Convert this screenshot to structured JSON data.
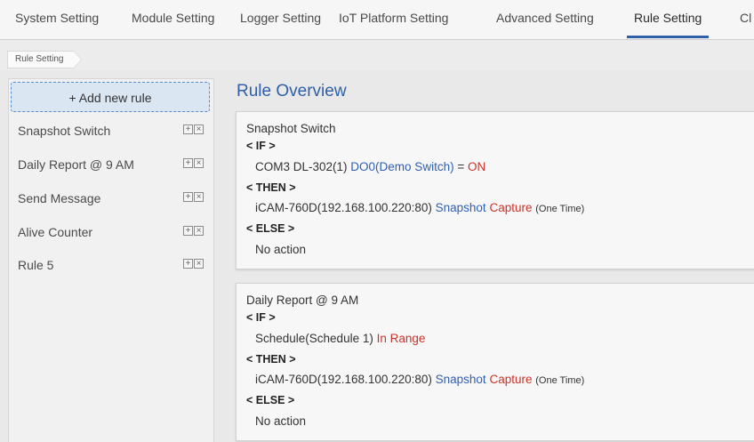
{
  "nav": {
    "tabs": [
      {
        "label": "System Setting"
      },
      {
        "label": "Module Setting"
      },
      {
        "label": "Logger Setting"
      },
      {
        "label": "IoT Platform Setting"
      },
      {
        "label": "Advanced Setting"
      },
      {
        "label": "Rule Setting",
        "active": true
      },
      {
        "label": "Cl"
      }
    ]
  },
  "breadcrumb": {
    "label": "Rule Setting"
  },
  "sidebar": {
    "add_label": "+ Add new rule",
    "rules": [
      {
        "label": "Snapshot Switch"
      },
      {
        "label": "Daily Report @ 9 AM"
      },
      {
        "label": "Send Message"
      },
      {
        "label": "Alive Counter"
      },
      {
        "label": "Rule 5"
      }
    ]
  },
  "main": {
    "title": "Rule Overview",
    "cards": [
      {
        "name": "Snapshot Switch",
        "if_kw": "< IF >",
        "if_device": "COM3 DL-302(1)",
        "if_channel": "DO0(Demo Switch)",
        "if_op": "=",
        "if_value": "ON",
        "then_kw": "< THEN >",
        "then_device": "iCAM-760D(192.168.100.220:80)",
        "then_action": "Snapshot",
        "then_value": "Capture",
        "then_note": "(One Time)",
        "else_kw": "< ELSE >",
        "else_text": "No action"
      },
      {
        "name": "Daily Report @ 9 AM",
        "if_kw": "< IF >",
        "if_device": "Schedule(Schedule 1)",
        "if_value": "In Range",
        "then_kw": "< THEN >",
        "then_device": "iCAM-760D(192.168.100.220:80)",
        "then_action": "Snapshot",
        "then_value": "Capture",
        "then_note": "(One Time)",
        "else_kw": "< ELSE >",
        "else_text": "No action"
      }
    ]
  },
  "colors": {
    "accent_blue": "#2f5fa8",
    "value_red": "#c8352c",
    "add_button_bg": "#dbe6f3"
  }
}
